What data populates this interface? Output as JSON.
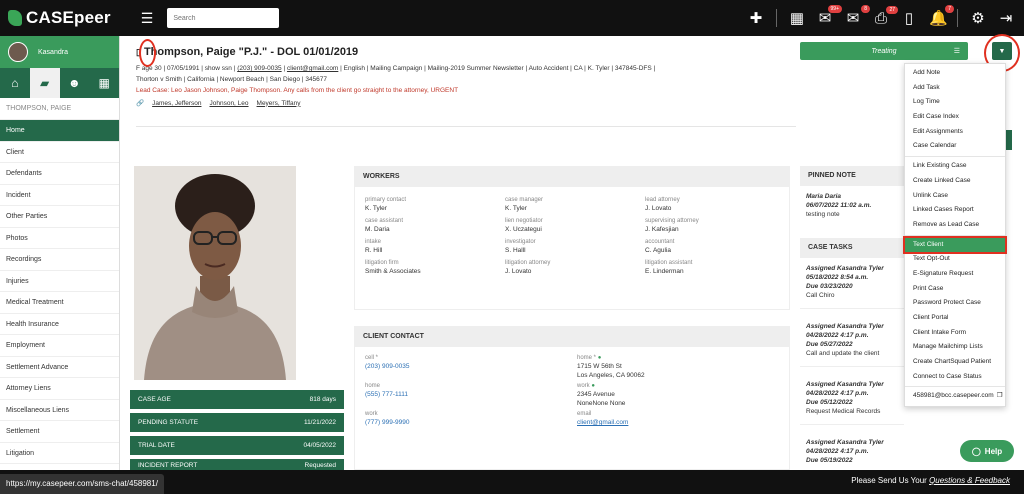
{
  "app": {
    "name": "CASEpeer",
    "search_placeholder": "Search",
    "badges": {
      "mail": "99+",
      "messages": "8",
      "inbox": "27",
      "notifications": "7"
    }
  },
  "sidebar": {
    "user_name": "Kasandra",
    "client_name": "THOMPSON, PAIGE",
    "items": [
      "Home",
      "Client",
      "Defendants",
      "Incident",
      "Other Parties",
      "Photos",
      "Recordings",
      "Injuries",
      "Medical Treatment",
      "Health Insurance",
      "Employment",
      "Settlement Advance",
      "Attorney Liens",
      "Miscellaneous Liens",
      "Settlement",
      "Litigation"
    ]
  },
  "case": {
    "title": "Thompson, Paige \"P.J.\" - DOL 01/01/2019",
    "meta_line1_pre": "F  age 30  |  07/05/1991  |  show ssn  | ",
    "phone": "(203) 909-0035",
    "email": "client@gmail.com",
    "meta_line1_post": "  |  English  |  Mailing Campaign  |  Mailing-2019 Summer Newsletter  |  Auto Accident  |  CA  |  K. Tyler  |  347845-DFS  |",
    "meta_line2": "Thorton v Smith  |  California  |  Newport Beach  |  San Diego  |  345677",
    "lead_case": "Lead Case: Leo Jason Johnson, Paige Thompson. Any calls from the client go straight to the attorney, URGENT",
    "related": [
      "James, Jefferson",
      "Johnson, Leo",
      "Meyers, Tiffany"
    ],
    "status": "Treating"
  },
  "stats": [
    {
      "label": "CASE AGE",
      "value": "818 days"
    },
    {
      "label": "PENDING STATUTE",
      "value": "11/21/2022"
    },
    {
      "label": "TRIAL DATE",
      "value": "04/05/2022"
    },
    {
      "label": "INCIDENT REPORT",
      "value": "Requested"
    }
  ],
  "workers": {
    "heading": "WORKERS",
    "fields": [
      {
        "label": "primary contact",
        "value": "K. Tyler"
      },
      {
        "label": "case manager",
        "value": "K. Tyler"
      },
      {
        "label": "lead attorney",
        "value": "J. Lovato"
      },
      {
        "label": "case assistant",
        "value": "M. Daria"
      },
      {
        "label": "lien negotiator",
        "value": "X. Uczategui"
      },
      {
        "label": "supervising attorney",
        "value": "J. Kafesjian"
      },
      {
        "label": "intake",
        "value": "R. Hill"
      },
      {
        "label": "investigator",
        "value": "S. Halll"
      },
      {
        "label": "accountant",
        "value": "C. Agulia"
      },
      {
        "label": "litigation firm",
        "value": "Smith & Associates"
      },
      {
        "label": "litigation attorney",
        "value": "J. Lovato"
      },
      {
        "label": "litigation assistant",
        "value": "E. Linderman"
      }
    ]
  },
  "client_contact": {
    "heading": "CLIENT CONTACT",
    "cell_label": "cell *",
    "cell": "(203) 909-0035",
    "home_label": "home",
    "home": "(555) 777-1111",
    "work_label": "work",
    "work": "(777) 999-9990",
    "home_addr_label": "home *",
    "home_addr1": "1715 W 56th St",
    "home_addr2": "Los Angeles, CA 90062",
    "work_addr_label": "work",
    "work_addr1": "2345 Avenue",
    "work_addr2": "NoneNone None",
    "email_label": "email",
    "email": "client@gmail.com"
  },
  "pinned_note": {
    "heading": "PINNED NOTE",
    "author": "Maria Daria",
    "date": "06/07/2022 11:02 a.m.",
    "text": "testing note"
  },
  "case_tasks": {
    "heading": "CASE TASKS",
    "tasks": [
      {
        "assigned": "Assigned Kasandra Tyler",
        "date": "05/18/2022 8:54 a.m.",
        "due": "Due 03/23/2020",
        "text": "Call Chiro"
      },
      {
        "assigned": "Assigned Kasandra Tyler",
        "date": "04/28/2022 4:17 p.m.",
        "due": "Due 05/27/2022",
        "text": "Call and update the client"
      },
      {
        "assigned": "Assigned Kasandra Tyler",
        "date": "04/28/2022 4:17 p.m.",
        "due": "Due 05/12/2022",
        "text": "Request Medical Records"
      },
      {
        "assigned": "Assigned Kasandra Tyler",
        "date": "04/28/2022 4:17 p.m.",
        "due": "Due 05/19/2022",
        "text": ""
      }
    ]
  },
  "dropdown": {
    "group1": [
      "Add Note",
      "Add Task",
      "Log Time",
      "Edit Case Index",
      "Edit Assignments",
      "Case Calendar"
    ],
    "group2": [
      "Link Existing Case",
      "Create Linked Case",
      "Unlink Case",
      "Linked Cases Report",
      "Remove as Lead Case"
    ],
    "group3": [
      "Text Client",
      "Text Opt-Out",
      "E-Signature Request",
      "Print Case",
      "Password Protect Case",
      "Client Portal",
      "Client Intake Form",
      "Manage Mailchimp Lists",
      "Create ChartSquad Patient",
      "Connect to Case Status"
    ],
    "email": "458981@bcc.casepeer.com"
  },
  "help_label": "Help",
  "footer": {
    "url": "https://my.casepeer.com/sms-chat/458981/",
    "feedback_pre": "Please Send Us Your ",
    "feedback_link": "Questions & Feedback"
  },
  "colors": {
    "brand_green": "#3a9b5c",
    "dark_green": "#24694a",
    "annotation_red": "#e03020"
  }
}
